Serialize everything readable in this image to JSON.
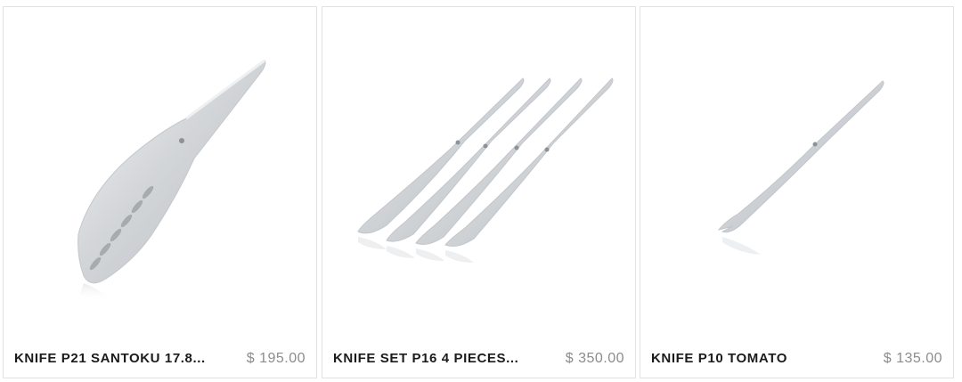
{
  "products": [
    {
      "name": "KNIFE P21 SANTOKU 17.8...",
      "price": "$ 195.00",
      "image": "santoku-knife"
    },
    {
      "name": "KNIFE SET P16 4 PIECES...",
      "price": "$ 350.00",
      "image": "steak-knife-set"
    },
    {
      "name": "KNIFE P10 TOMATO",
      "price": "$ 135.00",
      "image": "tomato-knife"
    }
  ]
}
